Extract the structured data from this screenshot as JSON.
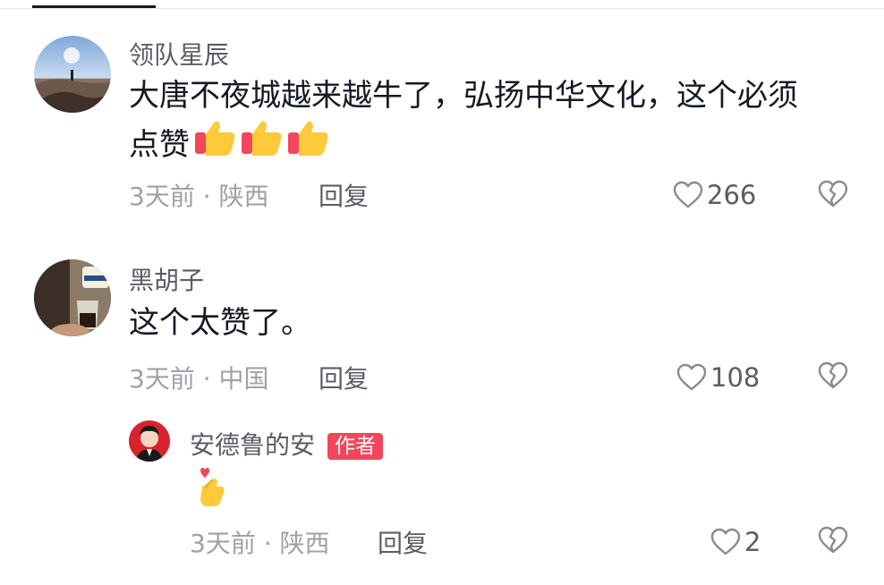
{
  "comments": [
    {
      "username": "领队星辰",
      "text_line1": "大唐不夜城越来越牛了，弘扬中华文化，这个必须",
      "text_line2": "点赞",
      "emojis": [
        "thumbs-up",
        "thumbs-up",
        "thumbs-up"
      ],
      "meta": "3天前 · 陕西",
      "reply_label": "回复",
      "likes": "266"
    },
    {
      "username": "黑胡子",
      "text_line1": "这个太赞了。",
      "meta": "3天前 · 中国",
      "reply_label": "回复",
      "likes": "108"
    }
  ],
  "reply": {
    "username": "安德鲁的安",
    "badge": "作者",
    "emoji": "finger-heart",
    "meta": "3天前 · 陕西",
    "reply_label": "回复",
    "likes": "2"
  },
  "colors": {
    "badge": "#f2465c",
    "text": "#161823",
    "secondary": "#a0a1a8"
  }
}
